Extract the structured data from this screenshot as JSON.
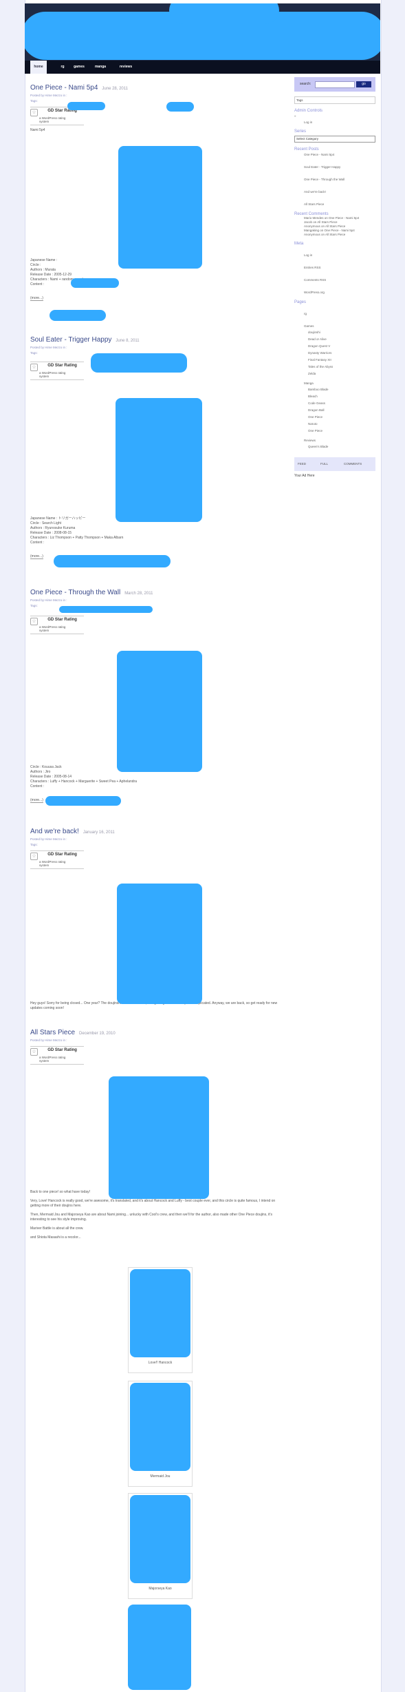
{
  "nav": {
    "tabs": [
      "home",
      "rg",
      "games",
      "manga",
      "reviews"
    ]
  },
  "sidebar": {
    "search_label": "search:",
    "search_button": "go",
    "tags_label": "Tags",
    "admin_heading": "Admin Controls",
    "login": "Log in",
    "series_heading": "Series",
    "select_category": "Select Category",
    "recent_posts_heading": "Recent Posts",
    "recent_posts": [
      "One Piece - Nami 5p4",
      "Soul Eater - Trigger Happy",
      "One Piece - Through the Wall",
      "And we're back!",
      "All Stars Piece"
    ],
    "recent_comments_heading": "Recent Comments",
    "recent_comments": [
      "Mario Mendes on One Piece - Nami 5p4",
      "Jacob on All Stars Piece",
      "Anonymous on All Stars Piece",
      "Mangaking on One Piece - Nami 5p4",
      "Anonymous on All Stars Piece"
    ],
    "meta_heading": "Meta",
    "meta_items": [
      "Log in",
      "Entries RSS",
      "Comments RSS",
      "WordPress.org"
    ],
    "pages_heading": "Pages",
    "pages": [
      "rg"
    ],
    "pages_games": "Games",
    "pages_games_sub": [
      "doujinshi",
      "Dead or Alive",
      "Dragon Quest V",
      "Dynasty Warriors",
      "Final Fantasy XII",
      "Tales of the Abyss",
      "Zelda"
    ],
    "pages_manga": "Manga",
    "pages_manga_sub": [
      "Bamboo Blade",
      "Bleach",
      "Code Geass",
      "Dragon Ball",
      "One Piece",
      "Naruto",
      "One Piece"
    ],
    "pages_reviews": "Reviews",
    "pages_reviews_sub": [
      "Queen's Blade"
    ],
    "feed_links": [
      "FEED",
      "FULL",
      "COMMENTS"
    ],
    "ad_label": "Your Ad Here"
  },
  "gd": {
    "title": "GD Star Rating",
    "line1": "a WordPress rating",
    "line2": "system"
  },
  "posts": [
    {
      "title": "One Piece - Nami 5p4",
      "date": "June 28, 2011",
      "meta": "Posted by Hime Mezzo in : ",
      "tags_prefix": "Tags: ",
      "excerpt": "Nami 5p4",
      "info": [
        "Japanese Name :",
        "Circle : ",
        "Authors : Murata",
        "Release Date : 2005-12-29",
        "Characters : Nami + random people",
        "Content : "
      ],
      "more": "(more...)"
    },
    {
      "title": "Soul Eater - Trigger Happy",
      "date": "June 8, 2011",
      "meta": "Posted by Hime Mezzo in : ",
      "tags_prefix": "Tags: ",
      "info": [
        "Japanese Name : トリガーハッピー",
        "Circle : Search Light",
        "Authors : Ryunosuke Kuruma",
        "Release Date : 2008-08-15",
        "Characters : Liz Thompson + Patty Thompson + Maka Albarn",
        "Content : "
      ],
      "more": "(more...)"
    },
    {
      "title": "One Piece - Through the Wall",
      "date": "March 28, 2011",
      "meta": "Posted by Hime Mezzo in : ",
      "tags_prefix": "Tags: ",
      "info": [
        "Circle : Kouusa Jack",
        "Authors : Jiro",
        "Release Date : 2005-08-14",
        "Characters : Luffy + Hancock + Marguerite + Sweet Pea + Aphelandra",
        "Content : "
      ],
      "more": "(more...)"
    },
    {
      "title": "And we're back!",
      "date": "January 16, 2011",
      "meta": "Posted by Hime Mezzo in : ",
      "tags_prefix": "Tags: ",
      "body": "Hey guys! Sorry for being closed... One year? The doujinshi-reader site was, and getting it back was quite complicated. Anyway, we are back, so get ready for new updates coming soon!"
    },
    {
      "title": "All Stars Piece",
      "date": "December 19, 2010",
      "meta": "Posted by Hime Mezzo in : ",
      "body": [
        "Back to one piece! so what have today!",
        "Very, Love! Hancock is really good, we're awesome, it's translated, and it's about Hancock and Luffy - best couple ever, and this circle is quite famous, I intend on getting more of their doujins here.",
        "Then, Mermaid Jou and Majorseya Kao are about Nami joining... unlucky with Cool's crew, and then we'll for the author, also made other One Piece doujins, it's interesting to see his style improving.",
        "Mariver Battle is about all the crew.",
        "and Shiota Masashi is a recolor..."
      ],
      "captions": [
        "Love!! Hancock",
        "Mermaid Jou",
        "Majorseya Kao"
      ]
    }
  ]
}
